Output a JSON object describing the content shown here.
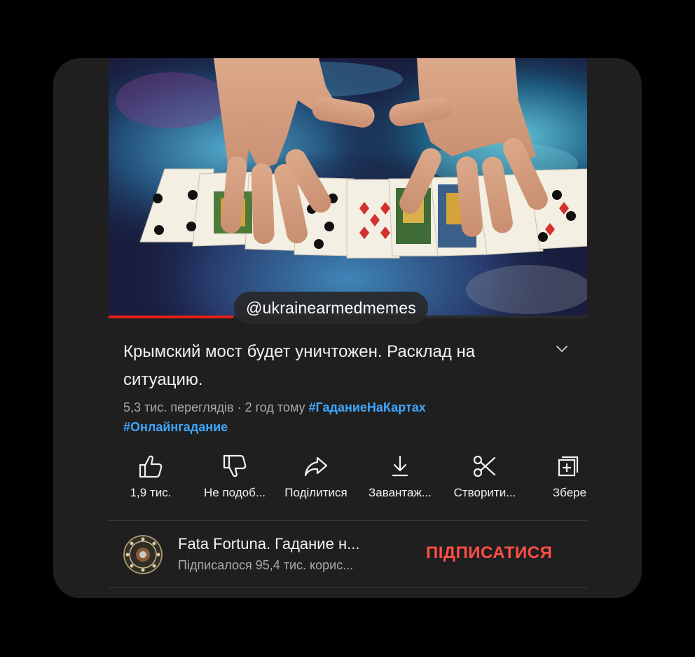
{
  "watermark": "@ukrainearmedmemes",
  "video": {
    "title": "Крымский мост будет уничтожен. Расклад на ситуацию.",
    "views": "5,3 тис. переглядів",
    "separator": " · ",
    "age": "2 год тому",
    "hashtags": [
      "#ГаданиеНаКартах",
      "#Онлайнгадание"
    ],
    "progress_fraction": 0.26
  },
  "actions": [
    {
      "label": "1,9 тис.",
      "icon": "thumbs-up-icon"
    },
    {
      "label": "Не подоб...",
      "icon": "thumbs-down-icon"
    },
    {
      "label": "Поділитися",
      "icon": "share-icon"
    },
    {
      "label": "Завантаж...",
      "icon": "download-icon"
    },
    {
      "label": "Створити...",
      "icon": "scissors-icon"
    },
    {
      "label": "Збере",
      "icon": "save-playlist-icon"
    }
  ],
  "channel": {
    "name": "Fata Fortuna. Гадание н...",
    "subscribers": "Підписалося 95,4 тис. корис...",
    "subscribe_label": "ПІДПИСАТИСЯ"
  },
  "colors": {
    "background": "#000000",
    "card": "#1f1f1f",
    "hashtag": "#3ea6ff",
    "subscribe": "#ff4e45",
    "progress": "#e62117"
  }
}
